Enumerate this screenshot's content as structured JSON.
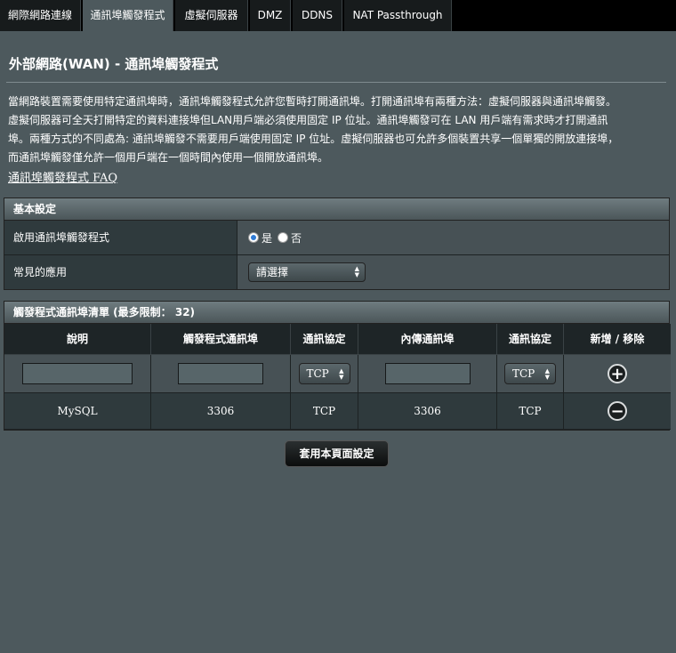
{
  "tabs": [
    {
      "label": "網際網路連線",
      "active": false
    },
    {
      "label": "通訊埠觸發程式",
      "active": true
    },
    {
      "label": "虛擬伺服器",
      "active": false
    },
    {
      "label": "DMZ",
      "active": false
    },
    {
      "label": "DDNS",
      "active": false
    },
    {
      "label": "NAT Passthrough",
      "active": false
    }
  ],
  "page_title": "外部網路(WAN) - 通訊埠觸發程式",
  "description_lines": [
    "當網路裝置需要使用特定通訊埠時，通訊埠觸發程式允許您暫時打開通訊埠。打開通訊埠有兩種方法：虛擬伺服器與通訊埠觸發。",
    "虛擬伺服器可全天打開特定的資料連接埠但LAN用戶端必須使用固定 IP 位址。通訊埠觸發可在 LAN 用戶端有需求時才打開通訊",
    "埠。兩種方式的不同處為: 通訊埠觸發不需要用戶端使用固定 IP 位址。虛擬伺服器也可允許多個裝置共享一個單獨的開放連接埠，",
    "而通訊埠觸發僅允許一個用戶端在一個時間內使用一個開放通訊埠。"
  ],
  "faq_link": "通訊埠觸發程式 FAQ",
  "basic": {
    "header": "基本設定",
    "enable_label": "啟用通訊埠觸發程式",
    "yes_label": "是",
    "no_label": "否",
    "enabled": true,
    "common_app_label": "常見的應用",
    "common_app_value": "請選擇"
  },
  "trigger_list": {
    "header": "觸發程式通訊埠清單 (最多限制： 32)",
    "columns": [
      "說明",
      "觸發程式通訊埠",
      "通訊協定",
      "內傳通訊埠",
      "通訊協定",
      "新增 / 移除"
    ],
    "new_row": {
      "trigger_protocol": "TCP",
      "incoming_protocol": "TCP"
    },
    "rows": [
      {
        "description": "MySQL",
        "trigger_port": "3306",
        "trigger_protocol": "TCP",
        "incoming_port": "3306",
        "incoming_protocol": "TCP"
      }
    ]
  },
  "apply_button": "套用本頁面設定",
  "icons": {
    "add": "plus-circle-icon",
    "remove": "minus-circle-icon",
    "dropdown": "up-down-arrows-icon"
  }
}
